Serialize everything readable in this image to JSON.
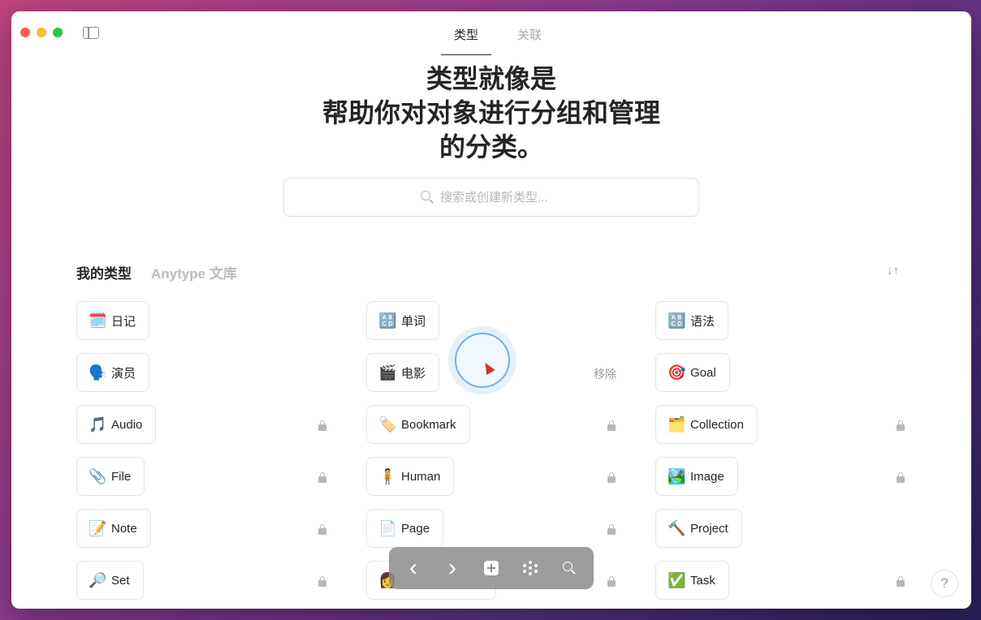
{
  "tabs": [
    "类型",
    "关联"
  ],
  "headline": [
    "类型就像是",
    "帮助你对对象进行分组和管理",
    "的分类。"
  ],
  "search": {
    "placeholder": "搜索或创建新类型..."
  },
  "section_tabs": [
    "我的类型",
    "Anytype 文库"
  ],
  "sort_icon": "↓↑",
  "types": [
    {
      "label": "日记",
      "emoji": "🗓️"
    },
    {
      "label": "单词",
      "emoji": "🔠"
    },
    {
      "label": "语法",
      "emoji": "🔠"
    },
    {
      "label": "演员",
      "emoji": "🗣️"
    },
    {
      "label": "电影",
      "emoji": "🎬"
    },
    {
      "label": "Goal",
      "emoji": "🎯"
    },
    {
      "label": "Audio",
      "emoji": "🎵"
    },
    {
      "label": "Bookmark",
      "emoji": "🏷️"
    },
    {
      "label": "Collection",
      "emoji": "🗂️"
    },
    {
      "label": "File",
      "emoji": "📎"
    },
    {
      "label": "Human",
      "emoji": "🧍"
    },
    {
      "label": "Image",
      "emoji": "🏞️"
    },
    {
      "label": "Note",
      "emoji": "📝"
    },
    {
      "label": "Page",
      "emoji": "📄"
    },
    {
      "label": "Project",
      "emoji": "🔨"
    },
    {
      "label": "Set",
      "emoji": "🔎"
    },
    {
      "label": "",
      "emoji": "👩"
    },
    {
      "label": "Task",
      "emoji": "✅"
    }
  ],
  "remove_label": "移除",
  "toolbar": {
    "back": "‹",
    "forward": "›"
  },
  "help": "?"
}
